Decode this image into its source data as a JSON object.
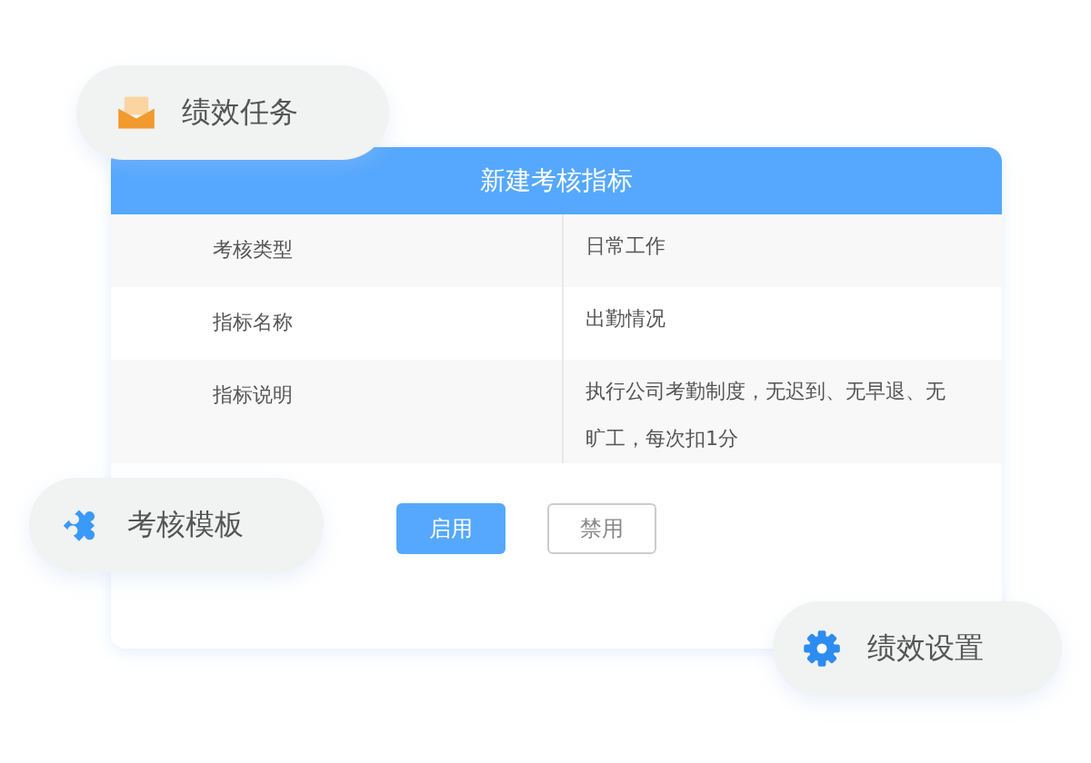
{
  "dialog": {
    "title": "新建考核指标",
    "rows": [
      {
        "label": "考核类型",
        "value": "日常工作"
      },
      {
        "label": "指标名称",
        "value": "出勤情况"
      },
      {
        "label": "指标说明",
        "value": "执行公司考勤制度，无迟到、无早退、无旷工，每次扣1分"
      }
    ],
    "buttons": [
      {
        "label": "启用",
        "kind": "primary"
      },
      {
        "label": "禁用",
        "kind": "plain"
      }
    ]
  },
  "floating_tags": [
    {
      "label": "绩效任务",
      "kind": "envelope"
    },
    {
      "label": "考核模板",
      "kind": "puzzle"
    },
    {
      "label": "绩效设置",
      "kind": "gear"
    }
  ]
}
